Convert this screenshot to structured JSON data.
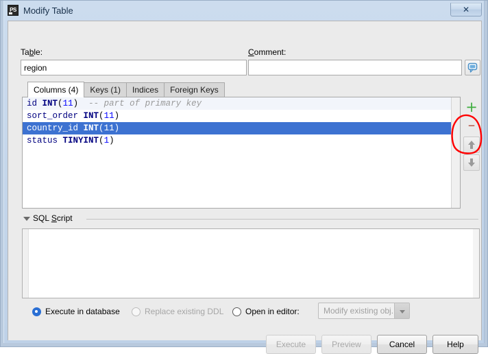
{
  "window": {
    "title": "Modify Table",
    "app_icon": "PS",
    "close_label": "✕",
    "icon_name": "application-icon"
  },
  "form": {
    "table_label_pre": "Ta",
    "table_label_mnemonic": "b",
    "table_label_post": "le:",
    "table_value": "region",
    "comment_label_mnemonic": "C",
    "comment_label_post": "omment:",
    "comment_value": "",
    "comment_icon": "comment-bubble-icon"
  },
  "tabs": [
    {
      "label": "Columns (4)",
      "active": true
    },
    {
      "label": "Keys (1)",
      "active": false
    },
    {
      "label": "Indices",
      "active": false
    },
    {
      "label": "Foreign Keys",
      "active": false
    }
  ],
  "columns": [
    {
      "name": "id",
      "type": "INT",
      "size": "11",
      "comment": "-- part of primary key",
      "selected": false,
      "first": true
    },
    {
      "name": "sort_order",
      "type": "INT",
      "size": "11",
      "comment": "",
      "selected": false,
      "first": false
    },
    {
      "name": "country_id",
      "type": "INT",
      "size": "11",
      "comment": "",
      "selected": true,
      "first": false
    },
    {
      "name": "status",
      "type": "TINYINT",
      "size": "1",
      "comment": "",
      "selected": false,
      "first": false
    }
  ],
  "side_toolbar": {
    "add_glyph": "+",
    "add_name": "add-column-button",
    "remove_glyph": "–",
    "remove_name": "remove-column-button",
    "move_up_name": "move-up-button",
    "move_down_name": "move-down-button",
    "add_color": "#3fae3f",
    "remove_color": "#b5584a",
    "arrow_color": "#9a9a9a"
  },
  "annotation": {
    "shape": "ellipse",
    "color": "#ff0000",
    "target": "move-up-down-buttons"
  },
  "sql_section": {
    "title_mnemonic_pre": "SQL ",
    "title_mnemonic": "S",
    "title_post": "cript",
    "expanded": true,
    "content": ""
  },
  "options": {
    "execute_in_database": {
      "label": "Execute in database",
      "checked": true,
      "enabled": true
    },
    "replace_existing_ddl": {
      "label": "Replace existing DDL",
      "checked": false,
      "enabled": false
    },
    "open_in_editor": {
      "label": "Open in editor:",
      "checked": false,
      "enabled": true
    },
    "editor_select": {
      "value": "Modify existing obj...",
      "enabled": false
    }
  },
  "buttons": {
    "execute": {
      "label": "Execute",
      "enabled": false
    },
    "preview": {
      "label": "Preview",
      "enabled": false
    },
    "cancel": {
      "label": "Cancel",
      "enabled": true
    },
    "help": {
      "label": "Help",
      "enabled": true
    }
  },
  "colors": {
    "selection_blue": "#3d72d1",
    "first_row_tint": "#f2f5fb",
    "dialog_bg": "#ebebeb",
    "identifier": "#000080",
    "number": "#0000ff",
    "comment_gray": "#9a9a9a",
    "title_text": "#18304a"
  }
}
